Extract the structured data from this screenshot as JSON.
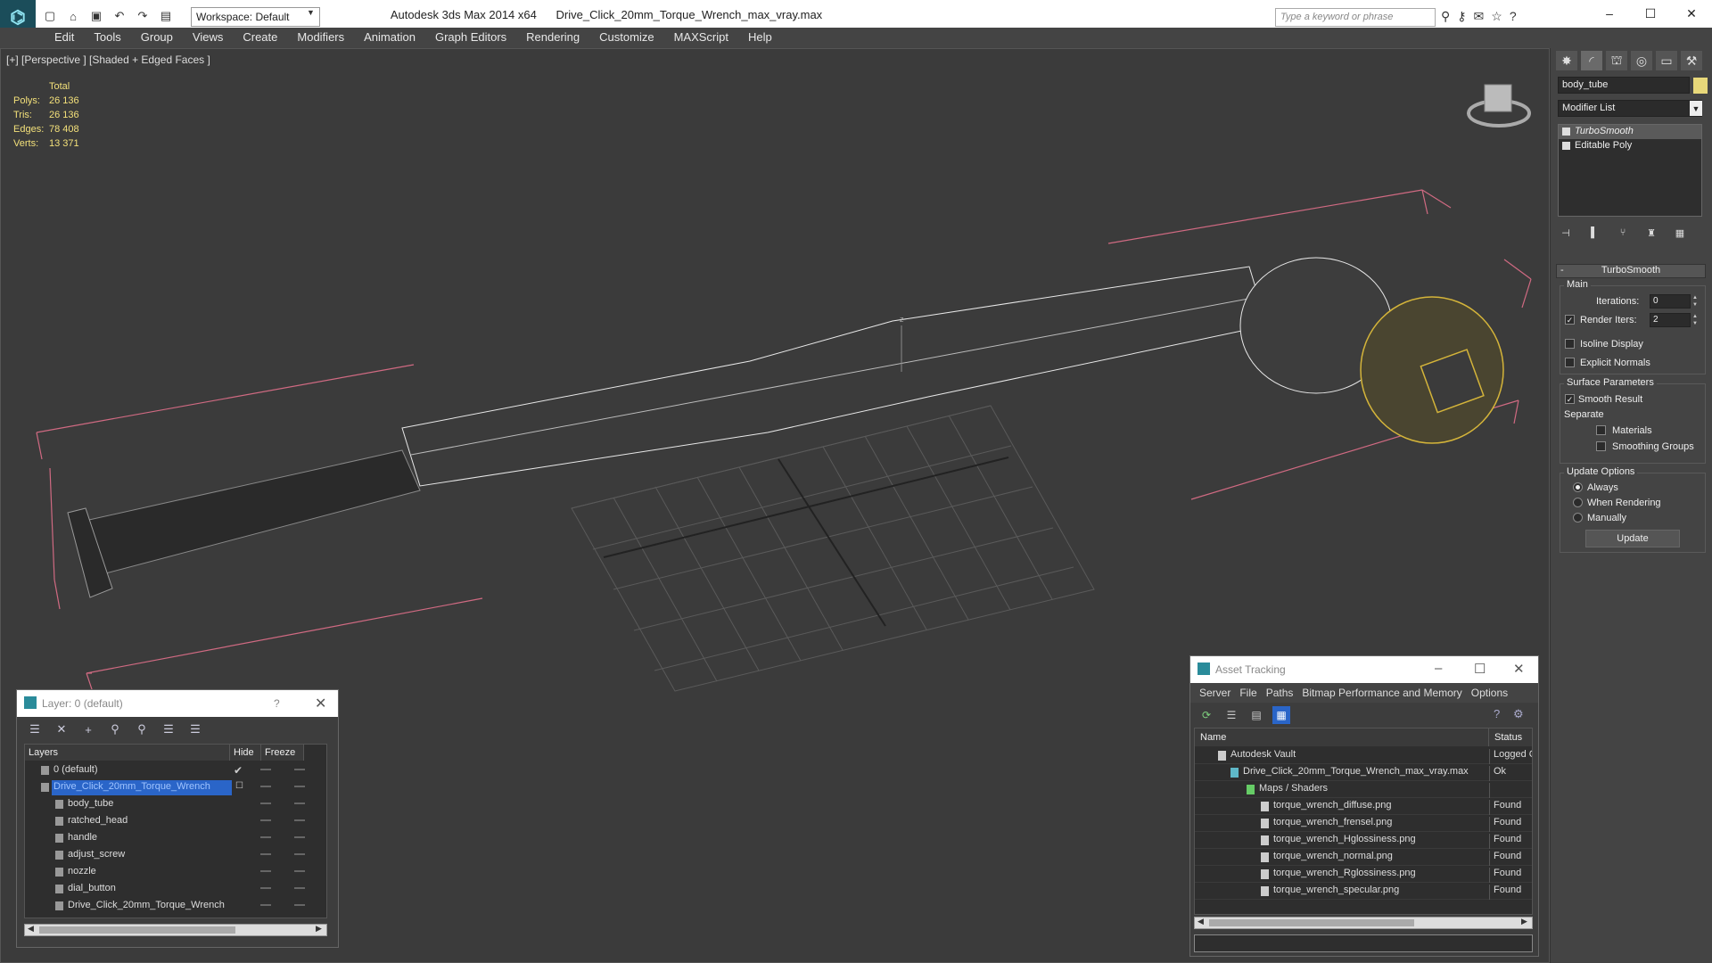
{
  "window": {
    "app_title": "Autodesk 3ds Max  2014 x64",
    "file_title": "Drive_Click_20mm_Torque_Wrench_max_vray.max",
    "workspace": "Workspace: Default",
    "search_placeholder": "Type a keyword or phrase"
  },
  "menu": [
    "Edit",
    "Tools",
    "Group",
    "Views",
    "Create",
    "Modifiers",
    "Animation",
    "Graph Editors",
    "Rendering",
    "Customize",
    "MAXScript",
    "Help"
  ],
  "viewport": {
    "label": "[+] [Perspective ] [Shaded + Edged Faces ]",
    "stats_header": "Total",
    "stats": [
      {
        "key": "Polys:",
        "value": "26 136"
      },
      {
        "key": "Tris:",
        "value": "26 136"
      },
      {
        "key": "Edges:",
        "value": "78 408"
      },
      {
        "key": "Verts:",
        "value": "13 371"
      }
    ],
    "axis_label": "z"
  },
  "command_panel": {
    "object_name": "body_tube",
    "object_color": "#e8d87a",
    "modifier_list": "Modifier List",
    "stack": [
      "TurboSmooth",
      "Editable Poly"
    ],
    "rollout_title": "TurboSmooth",
    "main_group": "Main",
    "iterations_label": "Iterations:",
    "iterations_value": "0",
    "render_iters_label": "Render Iters:",
    "render_iters_value": "2",
    "render_iters_checked": true,
    "isoline_display": "Isoline Display",
    "explicit_normals": "Explicit Normals",
    "surface_params_group": "Surface Parameters",
    "smooth_result": "Smooth Result",
    "separate_label": "Separate",
    "materials": "Materials",
    "smoothing_groups": "Smoothing Groups",
    "update_options_group": "Update Options",
    "always": "Always",
    "when_rendering": "When Rendering",
    "manually": "Manually",
    "update_button": "Update"
  },
  "layer_explorer": {
    "title": "Layer: 0 (default)",
    "help": "?",
    "columns": [
      "Layers",
      "Hide",
      "Freeze"
    ],
    "rows": [
      {
        "name": "0 (default)",
        "level": 0,
        "type": "layer",
        "active": true
      },
      {
        "name": "Drive_Click_20mm_Torque_Wrench",
        "level": 0,
        "type": "layer",
        "selected": true
      },
      {
        "name": "body_tube",
        "level": 1,
        "type": "object"
      },
      {
        "name": "ratched_head",
        "level": 1,
        "type": "object"
      },
      {
        "name": "handle",
        "level": 1,
        "type": "object"
      },
      {
        "name": "adjust_screw",
        "level": 1,
        "type": "object"
      },
      {
        "name": "nozzle",
        "level": 1,
        "type": "object"
      },
      {
        "name": "dial_button",
        "level": 1,
        "type": "object"
      },
      {
        "name": "Drive_Click_20mm_Torque_Wrench",
        "level": 1,
        "type": "object"
      }
    ]
  },
  "asset_tracking": {
    "title": "Asset Tracking",
    "menu": [
      "Server",
      "File",
      "Paths",
      "Bitmap Performance and Memory",
      "Options"
    ],
    "columns": [
      "Name",
      "Status"
    ],
    "rows": [
      {
        "name": "Autodesk Vault",
        "status": "Logged C",
        "level": 0
      },
      {
        "name": "Drive_Click_20mm_Torque_Wrench_max_vray.max",
        "status": "Ok",
        "level": 1
      },
      {
        "name": "Maps / Shaders",
        "status": "",
        "level": 2
      },
      {
        "name": "torque_wrench_diffuse.png",
        "status": "Found",
        "level": 3
      },
      {
        "name": "torque_wrench_frensel.png",
        "status": "Found",
        "level": 3
      },
      {
        "name": "torque_wrench_Hglossiness.png",
        "status": "Found",
        "level": 3
      },
      {
        "name": "torque_wrench_normal.png",
        "status": "Found",
        "level": 3
      },
      {
        "name": "torque_wrench_Rglossiness.png",
        "status": "Found",
        "level": 3
      },
      {
        "name": "torque_wrench_specular.png",
        "status": "Found",
        "level": 3
      }
    ]
  }
}
